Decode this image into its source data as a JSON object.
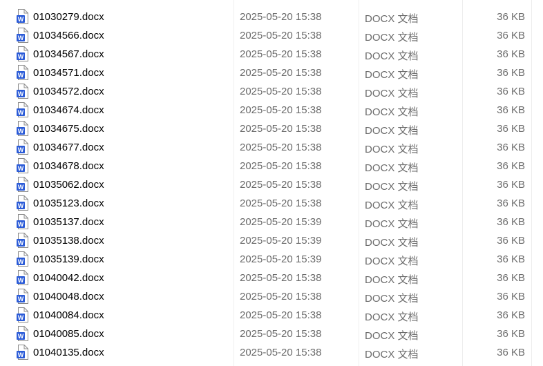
{
  "icon": "word-document-icon",
  "colors": {
    "icon_blue": "#2b5bd7",
    "secondary_text": "#6b6b6b"
  },
  "files": [
    {
      "name": "01030279.docx",
      "modified": "2025-05-20 15:38",
      "type": "DOCX 文档",
      "size": "36 KB"
    },
    {
      "name": "01034566.docx",
      "modified": "2025-05-20 15:38",
      "type": "DOCX 文档",
      "size": "36 KB"
    },
    {
      "name": "01034567.docx",
      "modified": "2025-05-20 15:38",
      "type": "DOCX 文档",
      "size": "36 KB"
    },
    {
      "name": "01034571.docx",
      "modified": "2025-05-20 15:38",
      "type": "DOCX 文档",
      "size": "36 KB"
    },
    {
      "name": "01034572.docx",
      "modified": "2025-05-20 15:38",
      "type": "DOCX 文档",
      "size": "36 KB"
    },
    {
      "name": "01034674.docx",
      "modified": "2025-05-20 15:38",
      "type": "DOCX 文档",
      "size": "36 KB"
    },
    {
      "name": "01034675.docx",
      "modified": "2025-05-20 15:38",
      "type": "DOCX 文档",
      "size": "36 KB"
    },
    {
      "name": "01034677.docx",
      "modified": "2025-05-20 15:38",
      "type": "DOCX 文档",
      "size": "36 KB"
    },
    {
      "name": "01034678.docx",
      "modified": "2025-05-20 15:38",
      "type": "DOCX 文档",
      "size": "36 KB"
    },
    {
      "name": "01035062.docx",
      "modified": "2025-05-20 15:38",
      "type": "DOCX 文档",
      "size": "36 KB"
    },
    {
      "name": "01035123.docx",
      "modified": "2025-05-20 15:38",
      "type": "DOCX 文档",
      "size": "36 KB"
    },
    {
      "name": "01035137.docx",
      "modified": "2025-05-20 15:39",
      "type": "DOCX 文档",
      "size": "36 KB"
    },
    {
      "name": "01035138.docx",
      "modified": "2025-05-20 15:39",
      "type": "DOCX 文档",
      "size": "36 KB"
    },
    {
      "name": "01035139.docx",
      "modified": "2025-05-20 15:39",
      "type": "DOCX 文档",
      "size": "36 KB"
    },
    {
      "name": "01040042.docx",
      "modified": "2025-05-20 15:38",
      "type": "DOCX 文档",
      "size": "36 KB"
    },
    {
      "name": "01040048.docx",
      "modified": "2025-05-20 15:38",
      "type": "DOCX 文档",
      "size": "36 KB"
    },
    {
      "name": "01040084.docx",
      "modified": "2025-05-20 15:38",
      "type": "DOCX 文档",
      "size": "36 KB"
    },
    {
      "name": "01040085.docx",
      "modified": "2025-05-20 15:38",
      "type": "DOCX 文档",
      "size": "36 KB"
    },
    {
      "name": "01040135.docx",
      "modified": "2025-05-20 15:38",
      "type": "DOCX 文档",
      "size": "36 KB"
    }
  ]
}
